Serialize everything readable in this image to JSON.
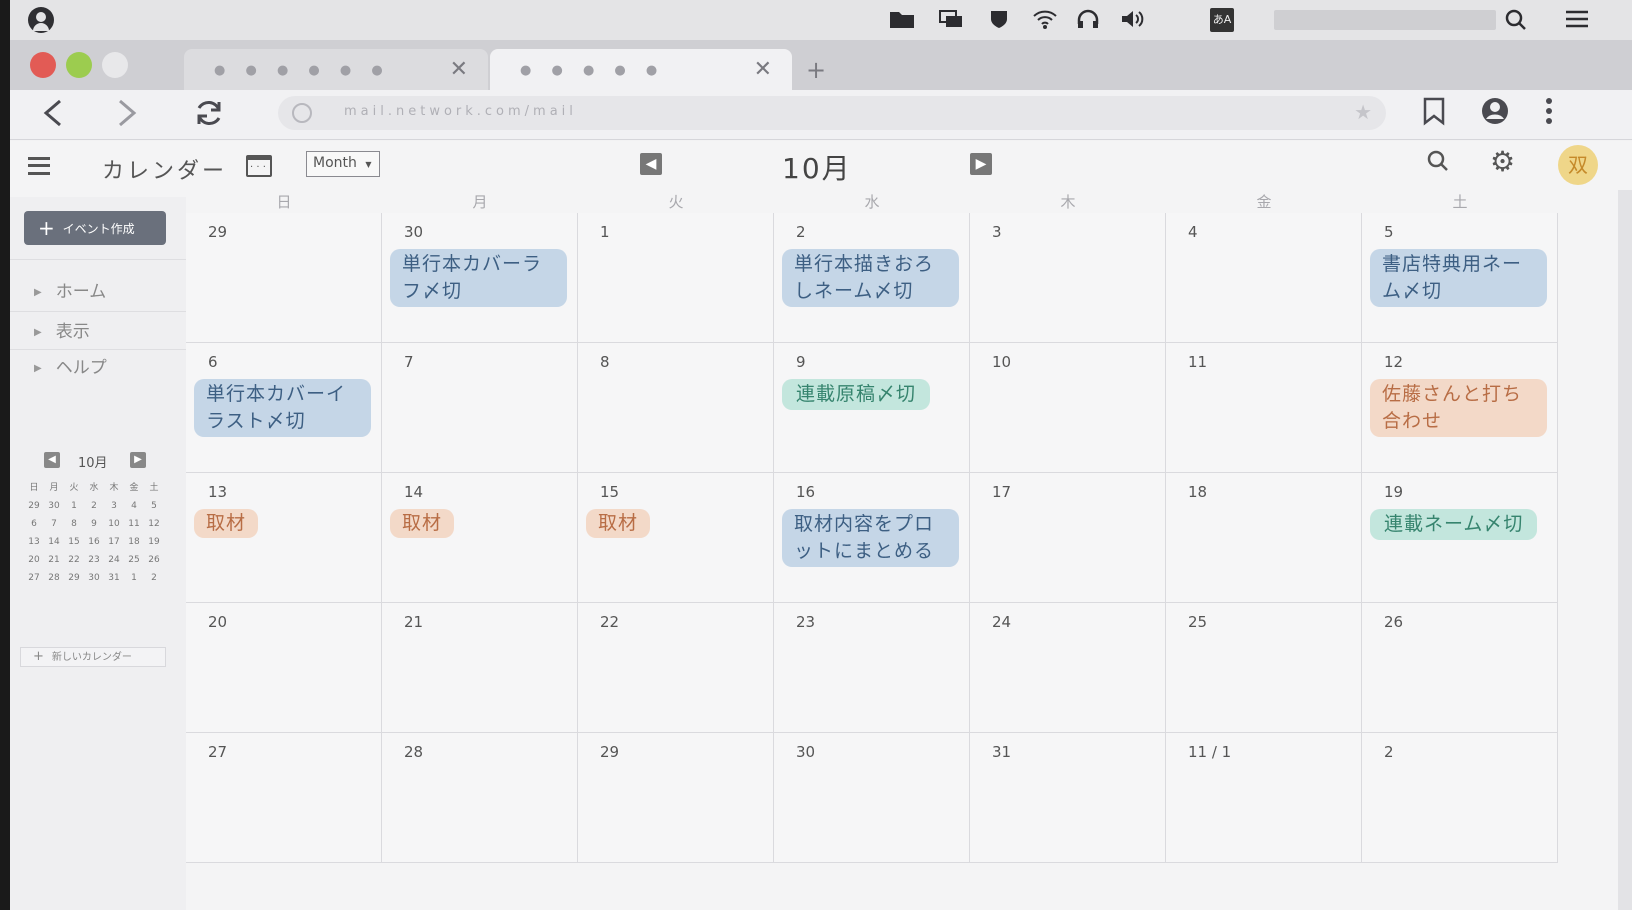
{
  "os": {
    "ime_label": "あA"
  },
  "browser": {
    "tab_inactive_title": "● ● ● ● ● ●",
    "tab_active_title": "● ● ● ● ●",
    "url": "mail.network.com/mail"
  },
  "app": {
    "title": "カレンダー",
    "view_select": "Month",
    "month_title": "10月",
    "avatar_initial": "双",
    "create_event_label": "イベント作成",
    "nav_items": [
      "ホーム",
      "表示",
      "ヘルプ"
    ],
    "new_calendar_label": "新しいカレンダー"
  },
  "mini_calendar": {
    "title": "10月",
    "weekdays": [
      "日",
      "月",
      "火",
      "水",
      "木",
      "金",
      "土"
    ],
    "days": [
      "29",
      "30",
      "1",
      "2",
      "3",
      "4",
      "5",
      "6",
      "7",
      "8",
      "9",
      "10",
      "11",
      "12",
      "13",
      "14",
      "15",
      "16",
      "17",
      "18",
      "19",
      "20",
      "21",
      "22",
      "23",
      "24",
      "25",
      "26",
      "27",
      "28",
      "29",
      "30",
      "31",
      "1",
      "2"
    ]
  },
  "weekdays": [
    "日",
    "月",
    "火",
    "水",
    "木",
    "金",
    "土"
  ],
  "weeks": [
    [
      "29",
      "30",
      "1",
      "2",
      "3",
      "4",
      "5"
    ],
    [
      "6",
      "7",
      "8",
      "9",
      "10",
      "11",
      "12"
    ],
    [
      "13",
      "14",
      "15",
      "16",
      "17",
      "18",
      "19"
    ],
    [
      "20",
      "21",
      "22",
      "23",
      "24",
      "25",
      "26"
    ],
    [
      "27",
      "28",
      "29",
      "30",
      "31",
      "11 / 1",
      "2"
    ]
  ],
  "events": [
    {
      "week": 0,
      "day": 1,
      "title": "単行本カバーラフ〆切",
      "color": "blue"
    },
    {
      "week": 0,
      "day": 3,
      "title": "単行本描きおろしネーム〆切",
      "color": "blue"
    },
    {
      "week": 0,
      "day": 6,
      "title": "書店特典用ネーム〆切",
      "color": "blue"
    },
    {
      "week": 1,
      "day": 0,
      "title": "単行本カバーイラスト〆切",
      "color": "blue"
    },
    {
      "week": 1,
      "day": 3,
      "title": "連載原稿〆切",
      "color": "green"
    },
    {
      "week": 1,
      "day": 6,
      "title": "佐藤さんと打ち合わせ",
      "color": "orange"
    },
    {
      "week": 2,
      "day": 0,
      "title": "取材",
      "color": "orange"
    },
    {
      "week": 2,
      "day": 1,
      "title": "取材",
      "color": "orange"
    },
    {
      "week": 2,
      "day": 2,
      "title": "取材",
      "color": "orange"
    },
    {
      "week": 2,
      "day": 3,
      "title": "取材内容をプロットにまとめる",
      "color": "blue"
    },
    {
      "week": 2,
      "day": 6,
      "title": "連載ネーム〆切",
      "color": "green"
    }
  ],
  "colors": {
    "blue": "#c5d6e7",
    "green": "#c3e6dd",
    "orange": "#f3d9c8"
  }
}
